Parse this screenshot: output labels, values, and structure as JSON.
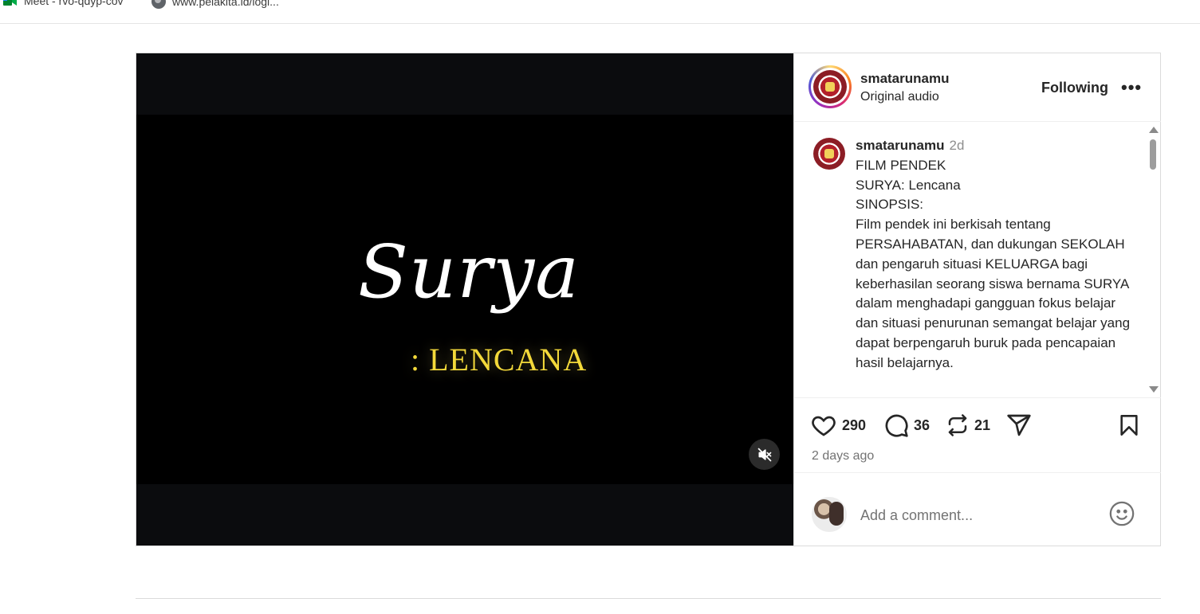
{
  "bookmarks": [
    {
      "label": "Meet - rvo-qdyp-cov",
      "icon": "google-meet-icon"
    },
    {
      "label": "www.pelakita.id/logi...",
      "icon": "globe-icon"
    }
  ],
  "video": {
    "title": "Surya",
    "subtitle": ": LENCANA",
    "muted": true
  },
  "header": {
    "username": "smatarunamu",
    "audio": "Original audio",
    "follow_label": "Following",
    "more_label": "•••"
  },
  "caption": {
    "username": "smatarunamu",
    "time": "2d",
    "lines": [
      "FILM PENDEK",
      "SURYA: Lencana",
      "SINOPSIS:",
      "Film pendek ini berkisah tentang PERSAHABATAN, dan dukungan SEKOLAH dan pengaruh situasi KELUARGA bagi keberhasilan seorang siswa bernama SURYA dalam menghadapi gangguan fokus belajar dan situasi penurunan semangat belajar yang dapat berpengaruh buruk pada pencapaian hasil belajarnya."
    ]
  },
  "actions": {
    "likes": "290",
    "comments": "36",
    "reposts": "21",
    "time_ago": "2 days ago"
  },
  "comment": {
    "placeholder": "Add a comment..."
  }
}
